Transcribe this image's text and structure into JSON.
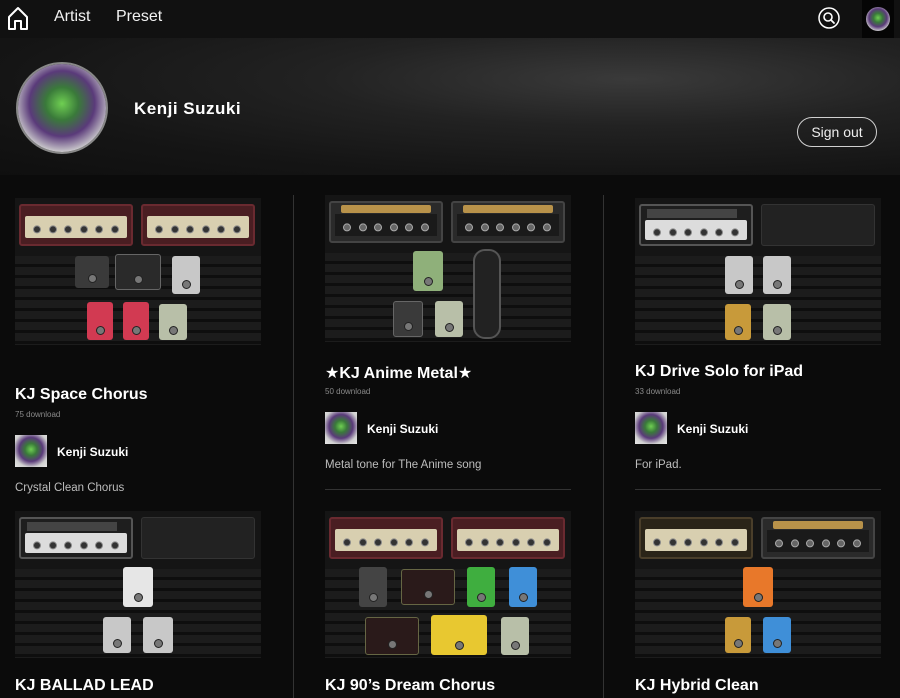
{
  "nav": {
    "home_icon": "home-icon",
    "artist_label": "Artist",
    "preset_label": "Preset",
    "search_icon": "search-icon"
  },
  "profile": {
    "name": "Kenji Suzuki",
    "sign_out_label": "Sign out"
  },
  "presets": [
    {
      "title": "KJ Space Chorus",
      "downloads": "75 download",
      "author": "Kenji Suzuki",
      "description": "Crystal Clean Chorus"
    },
    {
      "title": "★KJ Anime Metal★",
      "downloads": "50 download",
      "author": "Kenji Suzuki",
      "description": "Metal tone for The Anime song"
    },
    {
      "title": "KJ Drive Solo for iPad",
      "downloads": "33 download",
      "author": "Kenji Suzuki",
      "description": "For iPad."
    },
    {
      "title": "KJ BALLAD LEAD"
    },
    {
      "title": "KJ 90’s Dream Chorus"
    },
    {
      "title": "KJ Hybrid Clean"
    }
  ],
  "colors": {
    "background": "#0b0b0b",
    "topbar": "#111111",
    "text": "#ffffff",
    "muted": "#8a8a8a"
  }
}
